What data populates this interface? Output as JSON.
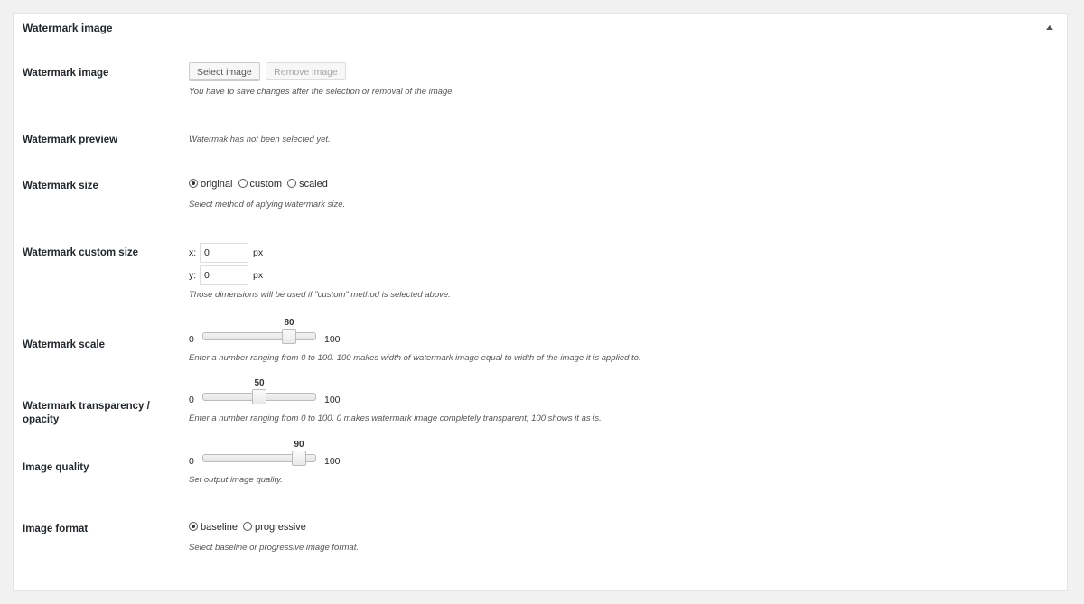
{
  "panel": {
    "title": "Watermark image"
  },
  "image": {
    "label": "Watermark image",
    "select_button": "Select image",
    "remove_button": "Remove image",
    "description": "You have to save changes after the selection or removal of the image."
  },
  "preview": {
    "label": "Watermark preview",
    "description": "Watermak has not been selected yet."
  },
  "size": {
    "label": "Watermark size",
    "options": [
      {
        "label": "original",
        "checked": true
      },
      {
        "label": "custom",
        "checked": false
      },
      {
        "label": "scaled",
        "checked": false
      }
    ],
    "description": "Select method of aplying watermark size."
  },
  "custom_size": {
    "label": "Watermark custom size",
    "x_prefix": "x:",
    "x_value": "0",
    "y_prefix": "y:",
    "y_value": "0",
    "unit": "px",
    "description": "Those dimensions will be used if \"custom\" method is selected above."
  },
  "scale": {
    "label": "Watermark scale",
    "min": "0",
    "max": "100",
    "value": 80,
    "value_label": "80",
    "description": "Enter a number ranging from 0 to 100. 100 makes width of watermark image equal to width of the image it is applied to."
  },
  "transparency": {
    "label": "Watermark transparency / opacity",
    "min": "0",
    "max": "100",
    "value": 50,
    "value_label": "50",
    "description": "Enter a number ranging from 0 to 100. 0 makes watermark image completely transparent, 100 shows it as is."
  },
  "quality": {
    "label": "Image quality",
    "min": "0",
    "max": "100",
    "value": 90,
    "value_label": "90",
    "description": "Set output image quality."
  },
  "format": {
    "label": "Image format",
    "options": [
      {
        "label": "baseline",
        "checked": true
      },
      {
        "label": "progressive",
        "checked": false
      }
    ],
    "description": "Select baseline or progressive image format."
  },
  "icons": {
    "collapse": "triangle-up-icon"
  }
}
